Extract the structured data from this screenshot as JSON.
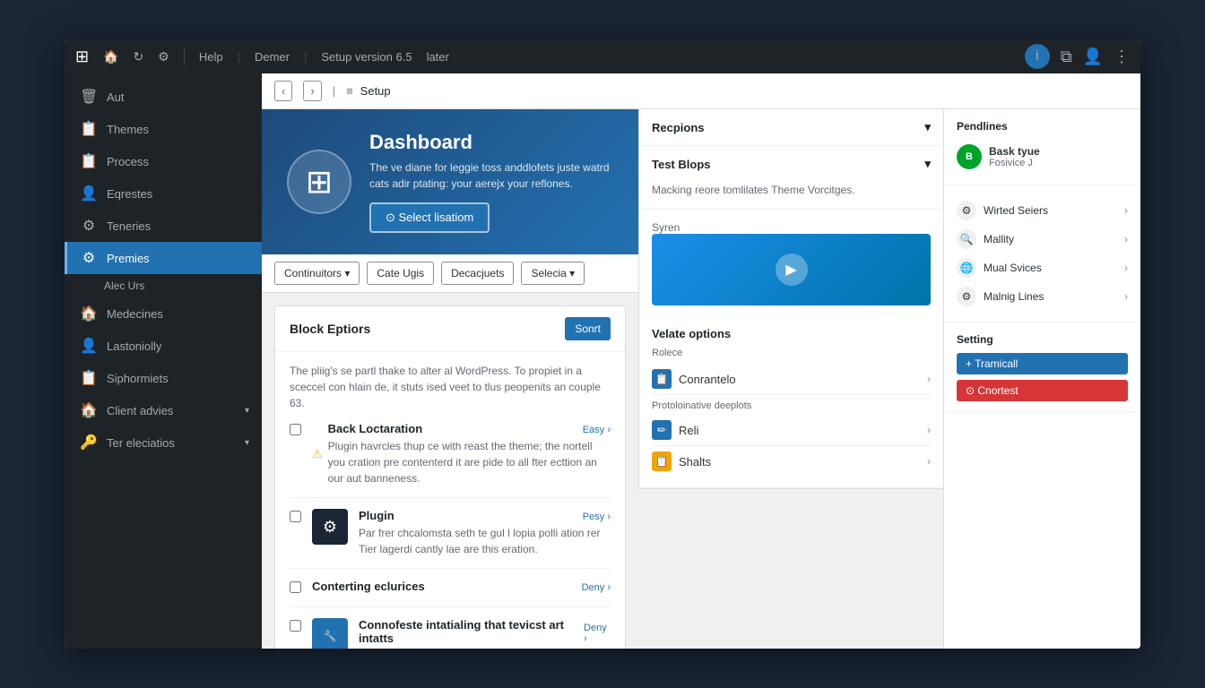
{
  "topbar": {
    "logo": "⊞",
    "icons": [
      "🏠",
      "↻",
      "⚙"
    ],
    "nav_items": [
      "Help",
      "Demer",
      "Setup version 6.5",
      "later"
    ],
    "right_icons": [
      "i",
      "⧉",
      "👤",
      "⋮"
    ]
  },
  "sidebar": {
    "items": [
      {
        "id": "aut",
        "icon": "🗑",
        "label": "Aut"
      },
      {
        "id": "themes",
        "icon": "📋",
        "label": "Themes"
      },
      {
        "id": "process",
        "icon": "📋",
        "label": "Process"
      },
      {
        "id": "eqrestes",
        "icon": "👤",
        "label": "Eqrestes"
      },
      {
        "id": "teneries",
        "icon": "⚙",
        "label": "Teneries"
      },
      {
        "id": "premies",
        "icon": "⚙",
        "label": "Premies",
        "active": true
      },
      {
        "id": "alec-urs",
        "icon": "",
        "label": "Alec Urs",
        "sub": true
      },
      {
        "id": "medecines",
        "icon": "🏠",
        "label": "Medecines"
      },
      {
        "id": "lastoniolly",
        "icon": "👤",
        "label": "Lastoniolly"
      },
      {
        "id": "siphormiets",
        "icon": "📋",
        "label": "Siphormiets"
      },
      {
        "id": "client-advies",
        "icon": "🏠",
        "label": "Client advies",
        "has_arrow": true
      },
      {
        "id": "ter-eleciatios",
        "icon": "🔑",
        "label": "Ter eleciatios",
        "has_arrow": true
      }
    ]
  },
  "subheader": {
    "setup_label": "Setup",
    "icon": "≡"
  },
  "hero": {
    "title": "Dashboard",
    "description": "The ve diane for leggie toss anddlofets juste watrd cats adir ptating: your aerejx your reflones.",
    "button_label": "⊙ Select lisatiom",
    "logo": "⊞"
  },
  "toolbar": {
    "buttons": [
      {
        "id": "continuitors",
        "label": "Continuitors ▾"
      },
      {
        "id": "cate-ugis",
        "label": "Cate Ugis"
      },
      {
        "id": "decacjuets",
        "label": "Decacjuets"
      },
      {
        "id": "selecia",
        "label": "Selecia ▾"
      }
    ]
  },
  "block_options": {
    "title": "Block Eptiors",
    "description": "The pliig's se partl thake to alter al WordPress. To propiet in a sceccel con hlain de, it stuts ised veet to tlus peopenits an couple 63.",
    "button_label": "Sonrt",
    "items": [
      {
        "id": "back-loctaration",
        "icon": "⚠",
        "name": "Back Loctaration",
        "badge": "Easy",
        "description": "Plugin havrcles thup ce with reast the theme; the nortell you cration pre contenterd it are pide to all fter ecttion an our aut banneness."
      },
      {
        "id": "plugin",
        "icon": "⚙",
        "name": "Plugin",
        "badge": "Pesy",
        "description": "Par frer chcalomsta seth te gul l lopia polli ation rer Tier lagerdi cantly lae are this eration.",
        "has_image": true
      },
      {
        "id": "conterting-eclurices",
        "icon": "📋",
        "name": "Conterting eclurices",
        "badge": "Deny"
      },
      {
        "id": "connofeste",
        "icon": "🔧",
        "name": "Connofeste intatialing that tevicst art intatts",
        "badge": "Deny"
      }
    ]
  },
  "recpions": {
    "title": "Recpions",
    "sections": [
      {
        "id": "test-blops",
        "label": "Test Blops",
        "content": "Macking reore tomlilates Theme Vorcitges."
      }
    ]
  },
  "video": {
    "label": "Syren"
  },
  "velate": {
    "title": "Velate options",
    "rolece_label": "Rolece",
    "items": [
      {
        "id": "conrantelo",
        "icon": "📋",
        "icon_color": "blue",
        "label": "Conrantelo"
      },
      {
        "id": "reli",
        "icon": "✏",
        "icon_color": "blue",
        "label": "Reli"
      },
      {
        "id": "shalts",
        "icon": "📋",
        "icon_color": "orange",
        "label": "Shalts"
      }
    ],
    "prodolo_label": "Protoloinative deeplots"
  },
  "pendlines": {
    "title": "Pendlines",
    "user": {
      "name": "Bask tyue",
      "subtitle": "Fosivice J",
      "avatar_initials": "B"
    },
    "items": [
      {
        "id": "wirted-seiers",
        "icon": "⚙",
        "label": "Wirted Seiers"
      },
      {
        "id": "mallity",
        "icon": "🔍",
        "label": "Mallity"
      },
      {
        "id": "mual-svices",
        "icon": "🌐",
        "label": "Mual Svices"
      },
      {
        "id": "malnig-lines",
        "icon": "⚙",
        "label": "Malnig Lines"
      }
    ],
    "setting": {
      "label": "Setting",
      "buttons": [
        {
          "id": "tramicall",
          "label": "+ Tramicall",
          "color": "blue"
        },
        {
          "id": "cnortest",
          "label": "⊙ Cnortest",
          "color": "red"
        }
      ]
    }
  }
}
